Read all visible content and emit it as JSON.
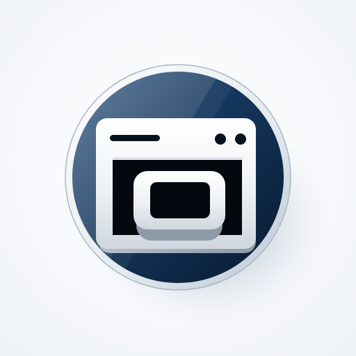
{
  "icon": {
    "name": "browser-window-icon",
    "colors": {
      "background": "#ffffff",
      "disc_dark": "#0b2442",
      "disc_mid": "#1f4670",
      "disc_light": "#3f6c97",
      "rim": "#f2f5f8",
      "shadow": "#7f95ad",
      "window_face": "#f4f6f8",
      "window_shade": "#c9d0d8",
      "inner_hole": "#050b14"
    }
  }
}
